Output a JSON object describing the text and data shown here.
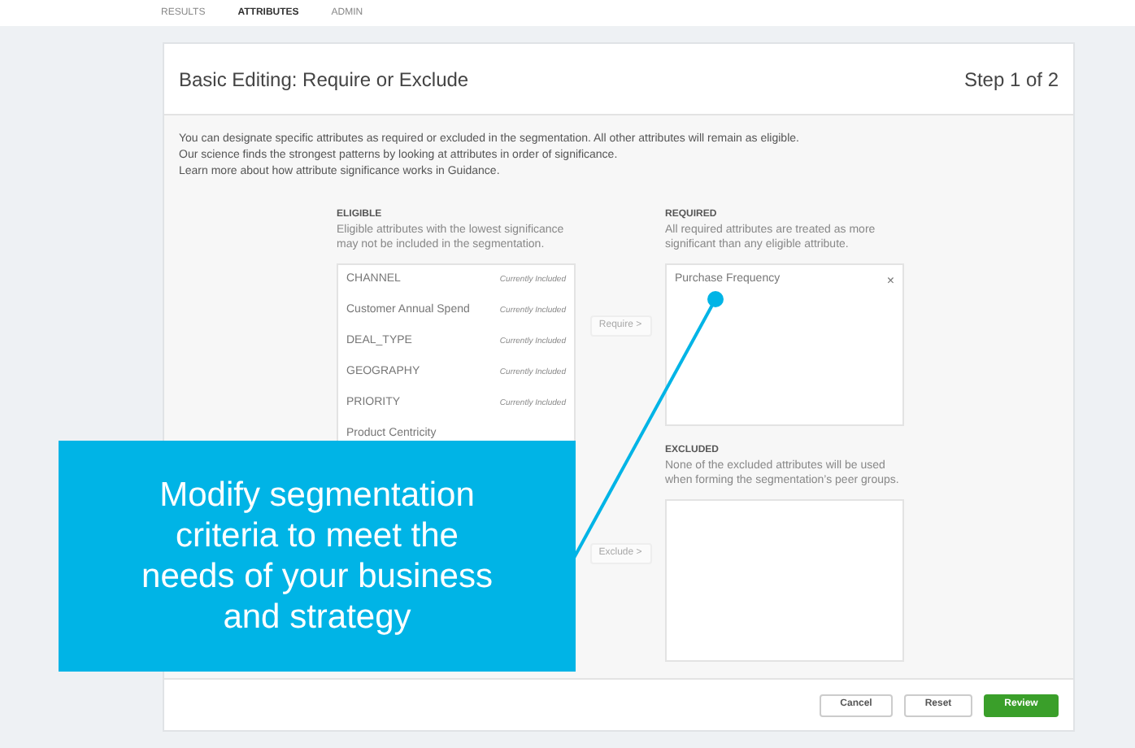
{
  "nav_tabs": [
    {
      "label": "RESULTS",
      "selected": false
    },
    {
      "label": "ATTRIBUTES",
      "selected": true
    },
    {
      "label": "ADMIN",
      "selected": false
    }
  ],
  "dialog": {
    "title": "Basic Editing: Require or Exclude",
    "step": "Step 1 of 2",
    "intro": [
      "You can designate specific attributes as required or excluded in the segmentation. All other attributes will remain as eligible.",
      "Our science finds the strongest patterns by looking at attributes in order of significance.",
      "Learn more about how attribute significance works in Guidance."
    ],
    "eligible": {
      "heading": "ELIGIBLE",
      "description": "Eligible attributes with the lowest significance may not be included in the segmentation.",
      "items": [
        {
          "name": "CHANNEL",
          "status": "Currently Included"
        },
        {
          "name": "Customer Annual Spend",
          "status": "Currently Included"
        },
        {
          "name": "DEAL_TYPE",
          "status": "Currently Included"
        },
        {
          "name": "GEOGRAPHY",
          "status": "Currently Included"
        },
        {
          "name": "PRIORITY",
          "status": "Currently Included"
        },
        {
          "name": "Product Centricity"
        }
      ]
    },
    "require_button": {
      "label": "Require >",
      "disabled": true
    },
    "exclude_button": {
      "label": "Exclude >",
      "disabled": true
    },
    "required": {
      "heading": "REQUIRED",
      "description": "All required attributes are treated as more significant than any eligible attribute.",
      "items": [
        {
          "name": "Purchase Frequency",
          "remove": "×"
        }
      ]
    },
    "excluded": {
      "heading": "EXCLUDED",
      "description": "None of the excluded attributes will be used when forming the segmentation’s peer groups."
    },
    "buttons": [
      {
        "label": "Cancel",
        "kind": "secondary"
      },
      {
        "label": "Reset",
        "kind": "secondary"
      },
      {
        "label": "Review",
        "kind": "primary"
      }
    ]
  },
  "callout": {
    "text": "Modify segmentation criteria to meet the needs of your business and strategy"
  }
}
